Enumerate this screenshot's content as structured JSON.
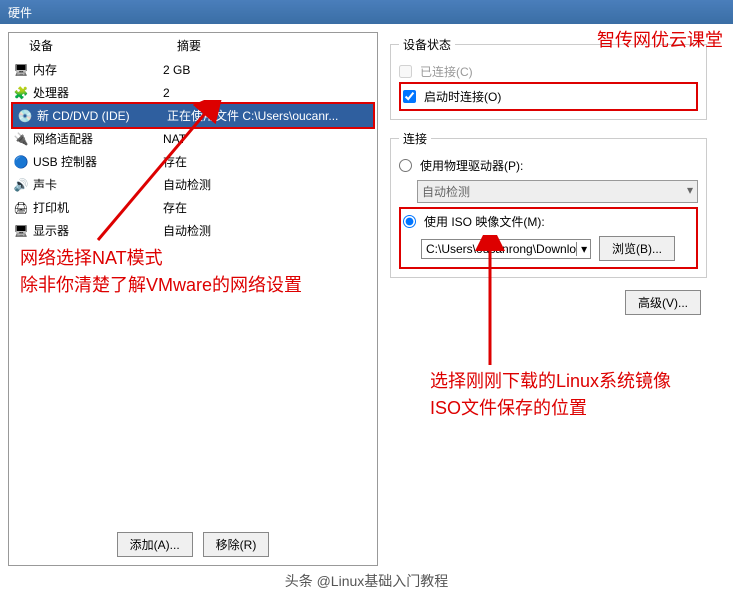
{
  "title": "硬件",
  "watermark": "智传网优云课堂",
  "columns": {
    "device": "设备",
    "summary": "摘要"
  },
  "devices": [
    {
      "icon": "🖥",
      "name": "内存",
      "summary": "2 GB"
    },
    {
      "icon": "🧩",
      "name": "处理器",
      "summary": "2"
    },
    {
      "icon": "💿",
      "name": "新 CD/DVD (IDE)",
      "summary": "正在使用文件 C:\\Users\\oucanr...",
      "selected": true
    },
    {
      "icon": "🔌",
      "name": "网络适配器",
      "summary": "NAT"
    },
    {
      "icon": "🔵",
      "name": "USB 控制器",
      "summary": "存在"
    },
    {
      "icon": "🔊",
      "name": "声卡",
      "summary": "自动检测"
    },
    {
      "icon": "🖨",
      "name": "打印机",
      "summary": "存在"
    },
    {
      "icon": "🖥",
      "name": "显示器",
      "summary": "自动检测"
    }
  ],
  "buttons": {
    "add": "添加(A)...",
    "remove": "移除(R)"
  },
  "status": {
    "legend": "设备状态",
    "connected": "已连接(C)",
    "connect_on_start": "启动时连接(O)"
  },
  "connection": {
    "legend": "连接",
    "use_physical": "使用物理驱动器(P):",
    "auto_detect": "自动检测",
    "use_iso": "使用 ISO 映像文件(M):",
    "iso_path": "C:\\Users\\oucanrong\\Downlo",
    "browse": "浏览(B)..."
  },
  "advanced": "高级(V)...",
  "annotations": {
    "nat": "网络选择NAT模式\n除非你清楚了解VMware的网络设置",
    "iso": "选择刚刚下载的Linux系统镜像\nISO文件保存的位置"
  },
  "bottom_watermark": "头条 @Linux基础入门教程"
}
